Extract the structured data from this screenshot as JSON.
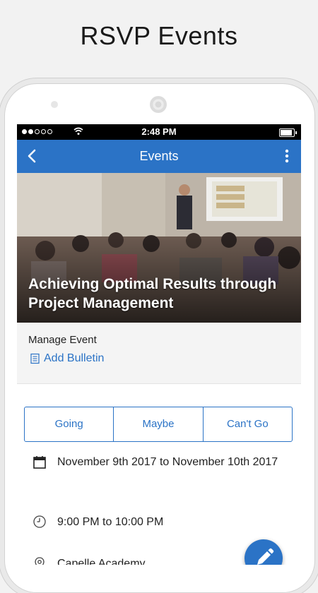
{
  "promo": {
    "title": "RSVP Events"
  },
  "statusbar": {
    "time": "2:48 PM"
  },
  "appbar": {
    "title": "Events"
  },
  "event": {
    "title": "Achieving Optimal Results through Project Management",
    "date_range": "November 9th 2017 to November 10th 2017",
    "time_range": "9:00 PM to 10:00 PM",
    "location": "Capelle Academy"
  },
  "manage": {
    "label": "Manage Event",
    "add_bulletin": "Add Bulletin"
  },
  "rsvp": {
    "going": "Going",
    "maybe": "Maybe",
    "cant_go": "Can't Go"
  },
  "colors": {
    "accent": "#2b73c6"
  }
}
